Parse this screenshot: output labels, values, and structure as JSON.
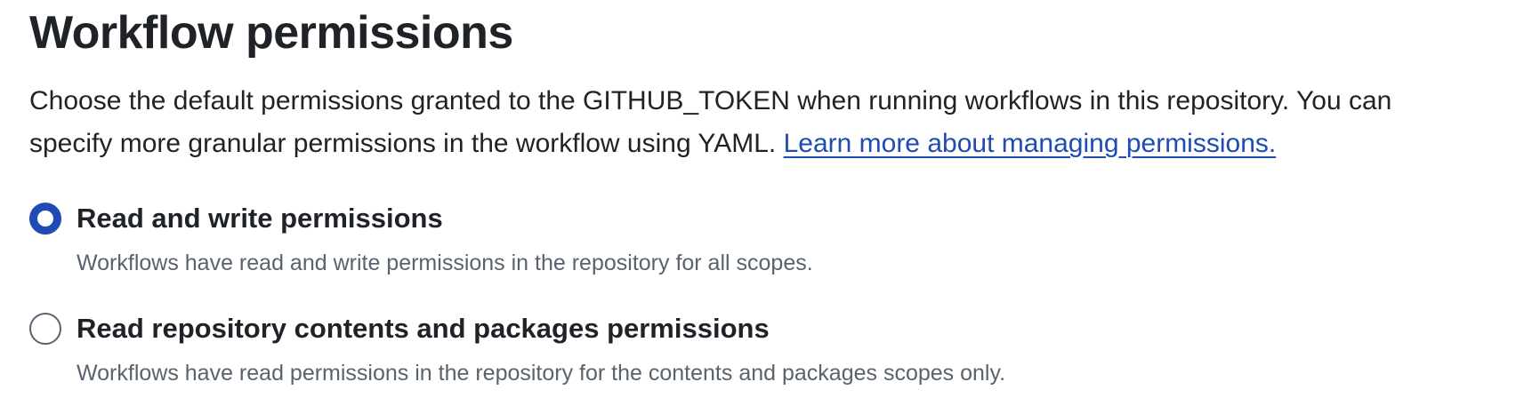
{
  "section": {
    "title": "Workflow permissions",
    "description_line1": "Choose the default permissions granted to the GITHUB_TOKEN when running workflows in this repository. You can",
    "description_line2": "specify more granular permissions in the workflow using YAML. ",
    "learn_more_link": "Learn more about managing permissions."
  },
  "options": [
    {
      "label": "Read and write permissions",
      "description": "Workflows have read and write permissions in the repository for all scopes.",
      "selected": true
    },
    {
      "label": "Read repository contents and packages permissions",
      "description": "Workflows have read permissions in the repository for the contents and packages scopes only.",
      "selected": false
    }
  ],
  "colors": {
    "accent": "#1f4bb5",
    "text_primary": "#1f2328",
    "text_muted": "#59636e"
  }
}
